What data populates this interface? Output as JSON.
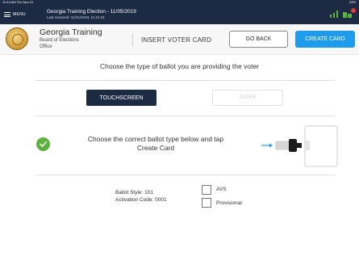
{
  "status_bar": {
    "left_text": "11:44 AM  Thu Nov 21",
    "right_text": "29%"
  },
  "app_bar": {
    "menu_label": "MENU",
    "title": "Georgia Training Election - 11/05/2019",
    "subtitle": "Last resumed: 11/21/2019, 11:21:34"
  },
  "header": {
    "office_name": "Georgia Training",
    "office_line1": "Board of Elections",
    "office_line2": "Office",
    "page_heading": "INSERT VOTER CARD",
    "go_back_label": "GO BACK",
    "create_card_label": "CREATE CARD"
  },
  "main": {
    "instruction": "Choose the type of ballot you are providing the voter",
    "touchscreen_label": "TOUCHSCREEN",
    "paper_label": "PAPER",
    "ballot_message_line1": "Choose the correct ballot type below and tap",
    "ballot_message_line2": "Create Card"
  },
  "details": {
    "ballot_style": "Ballot Style: 101",
    "activation_code": "Activation Code: 0001",
    "avs_label": "AVS",
    "provisional_label": "Provisional"
  },
  "colors": {
    "app_bar": "#1c2a44",
    "primary_button": "#1e9bea",
    "success": "#5ab43c",
    "selected_toggle": "#1c2a44"
  }
}
